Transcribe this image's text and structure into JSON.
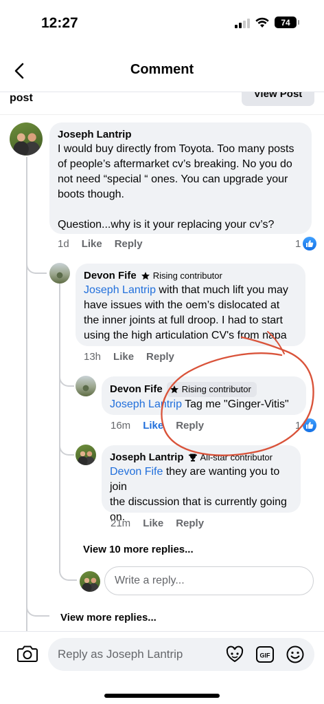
{
  "status_bar": {
    "time": "12:27",
    "battery": "74"
  },
  "header": {
    "title": "Comment"
  },
  "post": {
    "label": "post",
    "view_post": "View Post"
  },
  "comments": {
    "main": {
      "author": "Joseph Lantrip",
      "lines": [
        "I would buy directly from Toyota. Too many posts",
        "of people’s aftermarket cv’s breaking. No you do",
        "not need “special “ ones. You can upgrade your",
        "boots though.",
        "Question...why is it your replacing your cv’s?"
      ],
      "time": "1d",
      "like": "Like",
      "reply": "Reply",
      "likes": "1"
    },
    "reply1": {
      "author": "Devon Fife",
      "badge": "Rising contributor",
      "mention": "Joseph Lantrip",
      "line1": " with that much lift you may",
      "lines": [
        "have issues with the oem’s dislocated at",
        "the inner joints at full droop. I had to start",
        "using the high articulation CV's from napa"
      ],
      "time": "13h",
      "like": "Like",
      "reply": "Reply"
    },
    "reply2": {
      "author": "Devon Fife",
      "badge": "Rising contributor",
      "mention": "Joseph Lantrip",
      "text": " Tag me \"Ginger-Vitis\"",
      "time": "16m",
      "like": "Like",
      "reply": "Reply",
      "likes": "1"
    },
    "reply3": {
      "author": "Joseph Lantrip",
      "badge": "All-star contributor",
      "mention": "Devon Fife",
      "line1": " they are wanting you to join",
      "lines": [
        "the discussion that is currently going",
        "on."
      ],
      "time": "21m",
      "like": "Like",
      "reply": "Reply"
    }
  },
  "view_more_nested": "View 10 more replies...",
  "reply_box": {
    "placeholder": "Write a reply..."
  },
  "view_more": "View more replies...",
  "composer": {
    "placeholder": "Reply as Joseph Lantrip"
  },
  "colors": {
    "link": "#216fdb",
    "like_blue": "#1877f2",
    "annotation_red": "#d9533a"
  }
}
